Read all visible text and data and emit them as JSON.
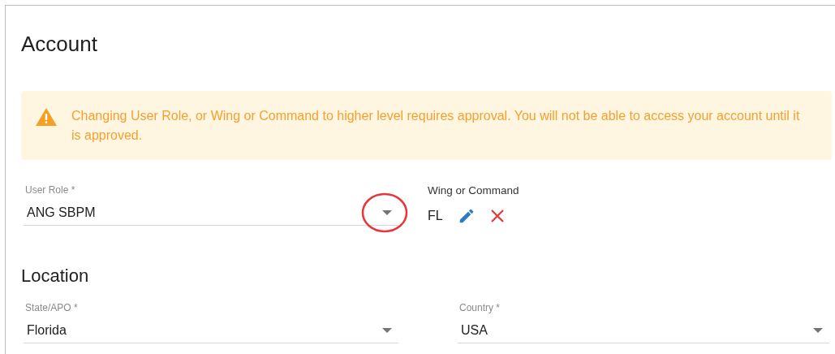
{
  "title": "Account",
  "alert": {
    "kind": "warning",
    "text": "Changing User Role, or Wing or Command to higher level requires approval. You will not be able to access your account until it is approved."
  },
  "user_role": {
    "label": "User Role *",
    "value": "ANG SBPM",
    "highlighted": true
  },
  "wing_or_command": {
    "label": "Wing or Command",
    "value": "FL"
  },
  "location": {
    "heading": "Location",
    "fields": [
      {
        "label": "State/APO *",
        "value": "Florida",
        "highlighted": false
      },
      {
        "label": "Country *",
        "value": "USA",
        "highlighted": false
      }
    ]
  }
}
